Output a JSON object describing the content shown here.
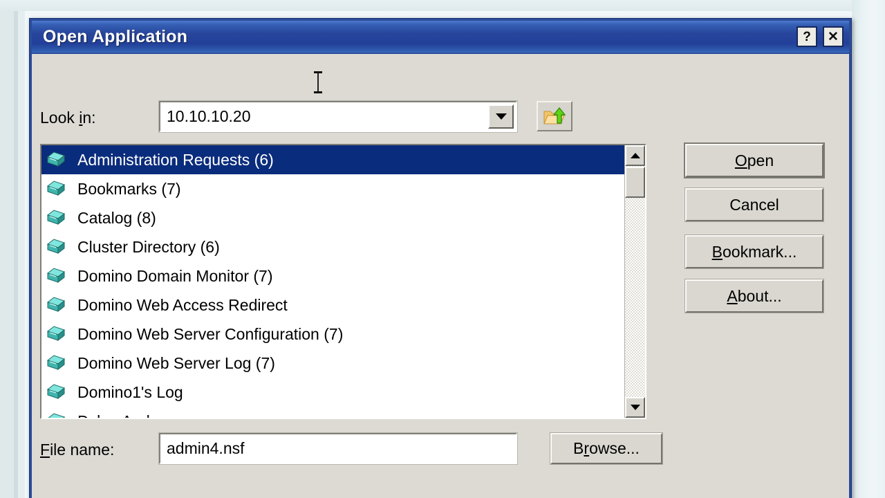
{
  "window": {
    "title": "Open Application",
    "help_button": "?",
    "close_button": "✕"
  },
  "lookin": {
    "label_pre": "Look ",
    "label_accel": "i",
    "label_post": "n:",
    "value": "10.10.10.20",
    "dropdown_icon": "chevron-down-icon",
    "up_one_level_icon": "up-one-level-folder-icon"
  },
  "list": {
    "selected_index": 0,
    "items": [
      {
        "label": "Administration Requests (6)",
        "icon": "database-book-icon"
      },
      {
        "label": "Bookmarks (7)",
        "icon": "database-book-icon"
      },
      {
        "label": "Catalog (8)",
        "icon": "database-book-icon"
      },
      {
        "label": "Cluster Directory (6)",
        "icon": "database-book-icon"
      },
      {
        "label": "Domino Domain Monitor (7)",
        "icon": "database-book-icon"
      },
      {
        "label": "Domino Web Access Redirect",
        "icon": "database-book-icon"
      },
      {
        "label": "Domino Web Server Configuration (7)",
        "icon": "database-book-icon"
      },
      {
        "label": "Domino Web Server Log (7)",
        "icon": "database-book-icon"
      },
      {
        "label": "Domino1's Log",
        "icon": "database-book-icon"
      },
      {
        "label": "Dylan Anderson",
        "icon": "database-book-icon"
      }
    ]
  },
  "scrollbar": {
    "up_icon": "scroll-up-arrow-icon",
    "down_icon": "scroll-down-arrow-icon"
  },
  "buttons": {
    "open": {
      "pre": "",
      "accel": "O",
      "post": "pen"
    },
    "cancel": {
      "pre": "Cancel",
      "accel": "",
      "post": ""
    },
    "bookmark": {
      "pre": "",
      "accel": "B",
      "post": "ookmark..."
    },
    "about": {
      "pre": "",
      "accel": "A",
      "post": "bout..."
    },
    "browse": {
      "pre": "B",
      "accel": "r",
      "post": "owse..."
    }
  },
  "filename": {
    "label_pre": "",
    "label_accel": "F",
    "label_post": "ile name:",
    "value": "admin4.nsf"
  },
  "colors": {
    "titlebar_blue": "#27459b",
    "selection_blue": "#0a2c7c",
    "dialog_face": "#dcdad3",
    "icon_teal": "#5fd3cd",
    "desktop": "#e3edef"
  }
}
